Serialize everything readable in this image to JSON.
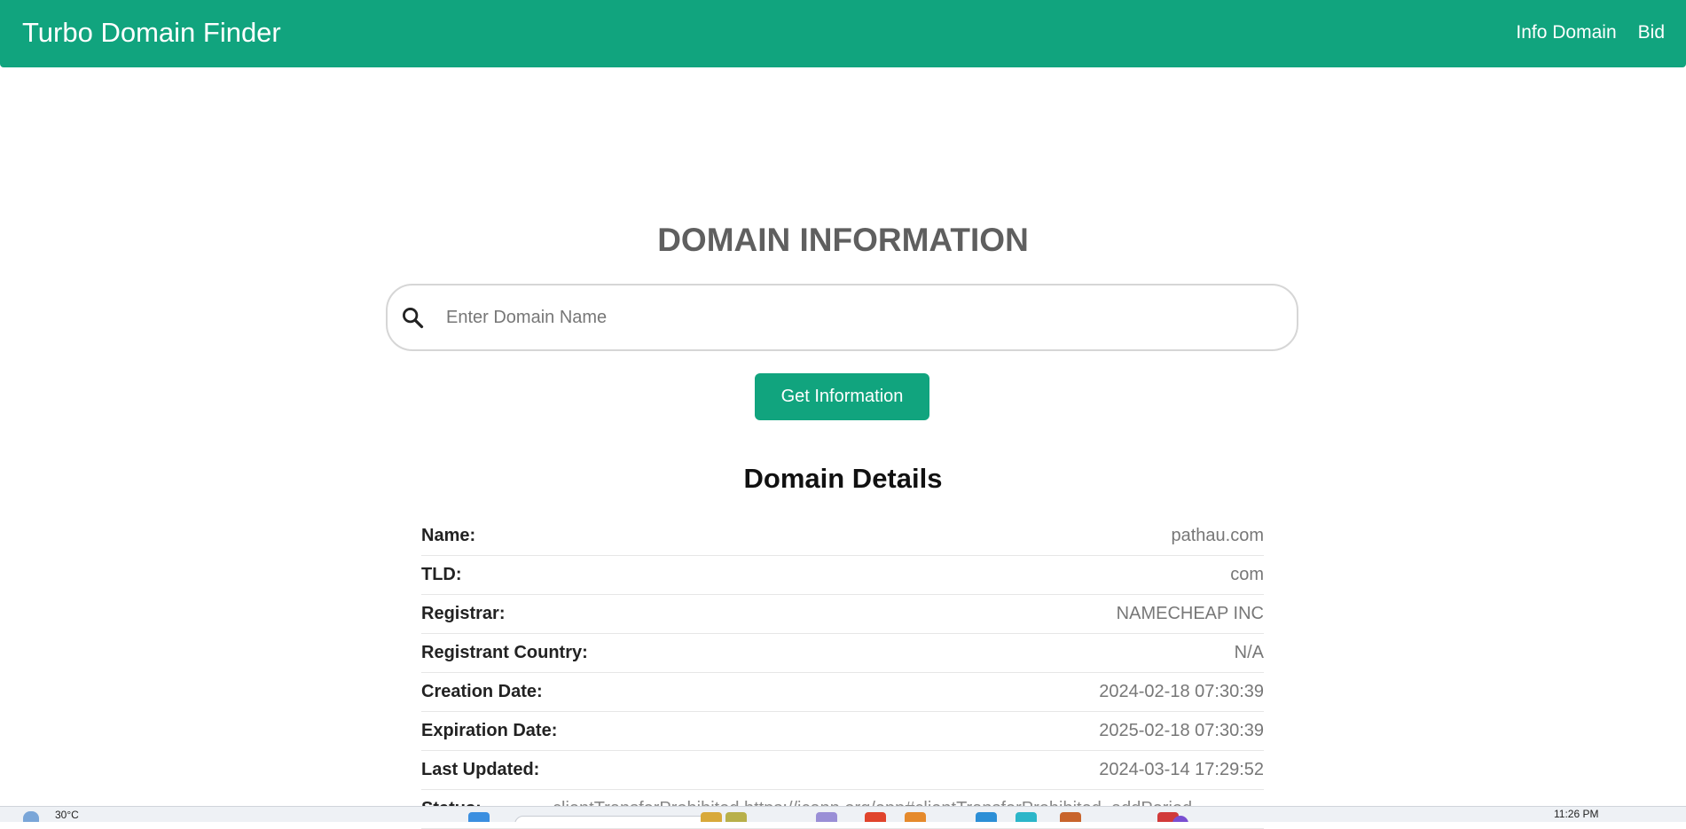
{
  "navbar": {
    "brand": "Turbo Domain Finder",
    "links": [
      "Info Domain",
      "Bid"
    ]
  },
  "main": {
    "title": "DOMAIN INFORMATION",
    "search": {
      "placeholder": "Enter Domain Name",
      "value": ""
    },
    "submit_label": "Get Information"
  },
  "details": {
    "heading": "Domain Details",
    "rows": [
      {
        "key": "Name:",
        "value": "pathau.com"
      },
      {
        "key": "TLD:",
        "value": "com"
      },
      {
        "key": "Registrar:",
        "value": "NAMECHEAP INC"
      },
      {
        "key": "Registrant Country:",
        "value": "N/A"
      },
      {
        "key": "Creation Date:",
        "value": "2024-02-18 07:30:39"
      },
      {
        "key": "Expiration Date:",
        "value": "2025-02-18 07:30:39"
      },
      {
        "key": "Last Updated:",
        "value": "2024-03-14 17:29:52"
      },
      {
        "key": "Status:",
        "value": "clientTransferProhibited https://icann.org/epp#clientTransferProhibited, addPeriod"
      }
    ]
  },
  "taskbar": {
    "weather": "30°C",
    "clock": "11:26 PM"
  },
  "colors": {
    "accent": "#11a47e",
    "title": "#5f5f5f",
    "value_text": "#777777"
  },
  "icons": {
    "search": "search-icon"
  }
}
